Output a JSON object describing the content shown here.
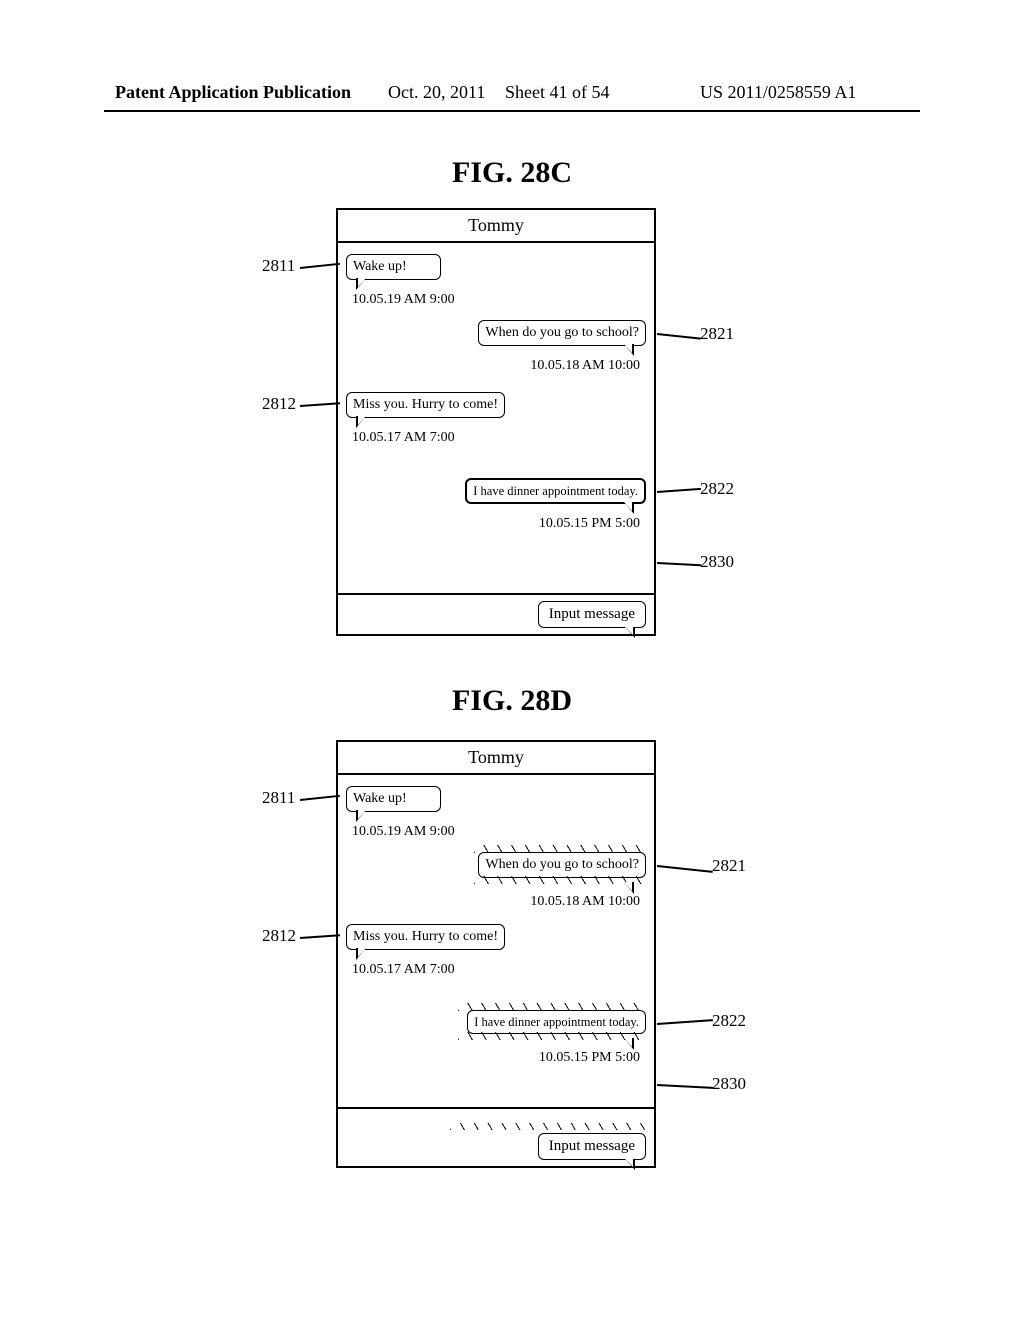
{
  "header": {
    "pub": "Patent Application Publication",
    "date": "Oct. 20, 2011",
    "sheet": "Sheet 41 of 54",
    "num": "US 2011/0258559 A1"
  },
  "figC": {
    "title": "FIG. 28C"
  },
  "figD": {
    "title": "FIG. 28D"
  },
  "phone": {
    "contact": "Tommy",
    "msg1": {
      "text": "Wake up!",
      "ts": "10.05.19 AM 9:00"
    },
    "msg2": {
      "text": "When do you go to school?",
      "ts": "10.05.18 AM 10:00"
    },
    "msg3": {
      "text": "Miss you. Hurry to come!",
      "ts": "10.05.17 AM 7:00"
    },
    "msg4": {
      "text": "I have dinner appointment today.",
      "ts": "10.05.15 PM 5:00"
    },
    "input": "Input message"
  },
  "refs": {
    "r2811": "2811",
    "r2812": "2812",
    "r2821": "2821",
    "r2822": "2822",
    "r2830": "2830"
  }
}
